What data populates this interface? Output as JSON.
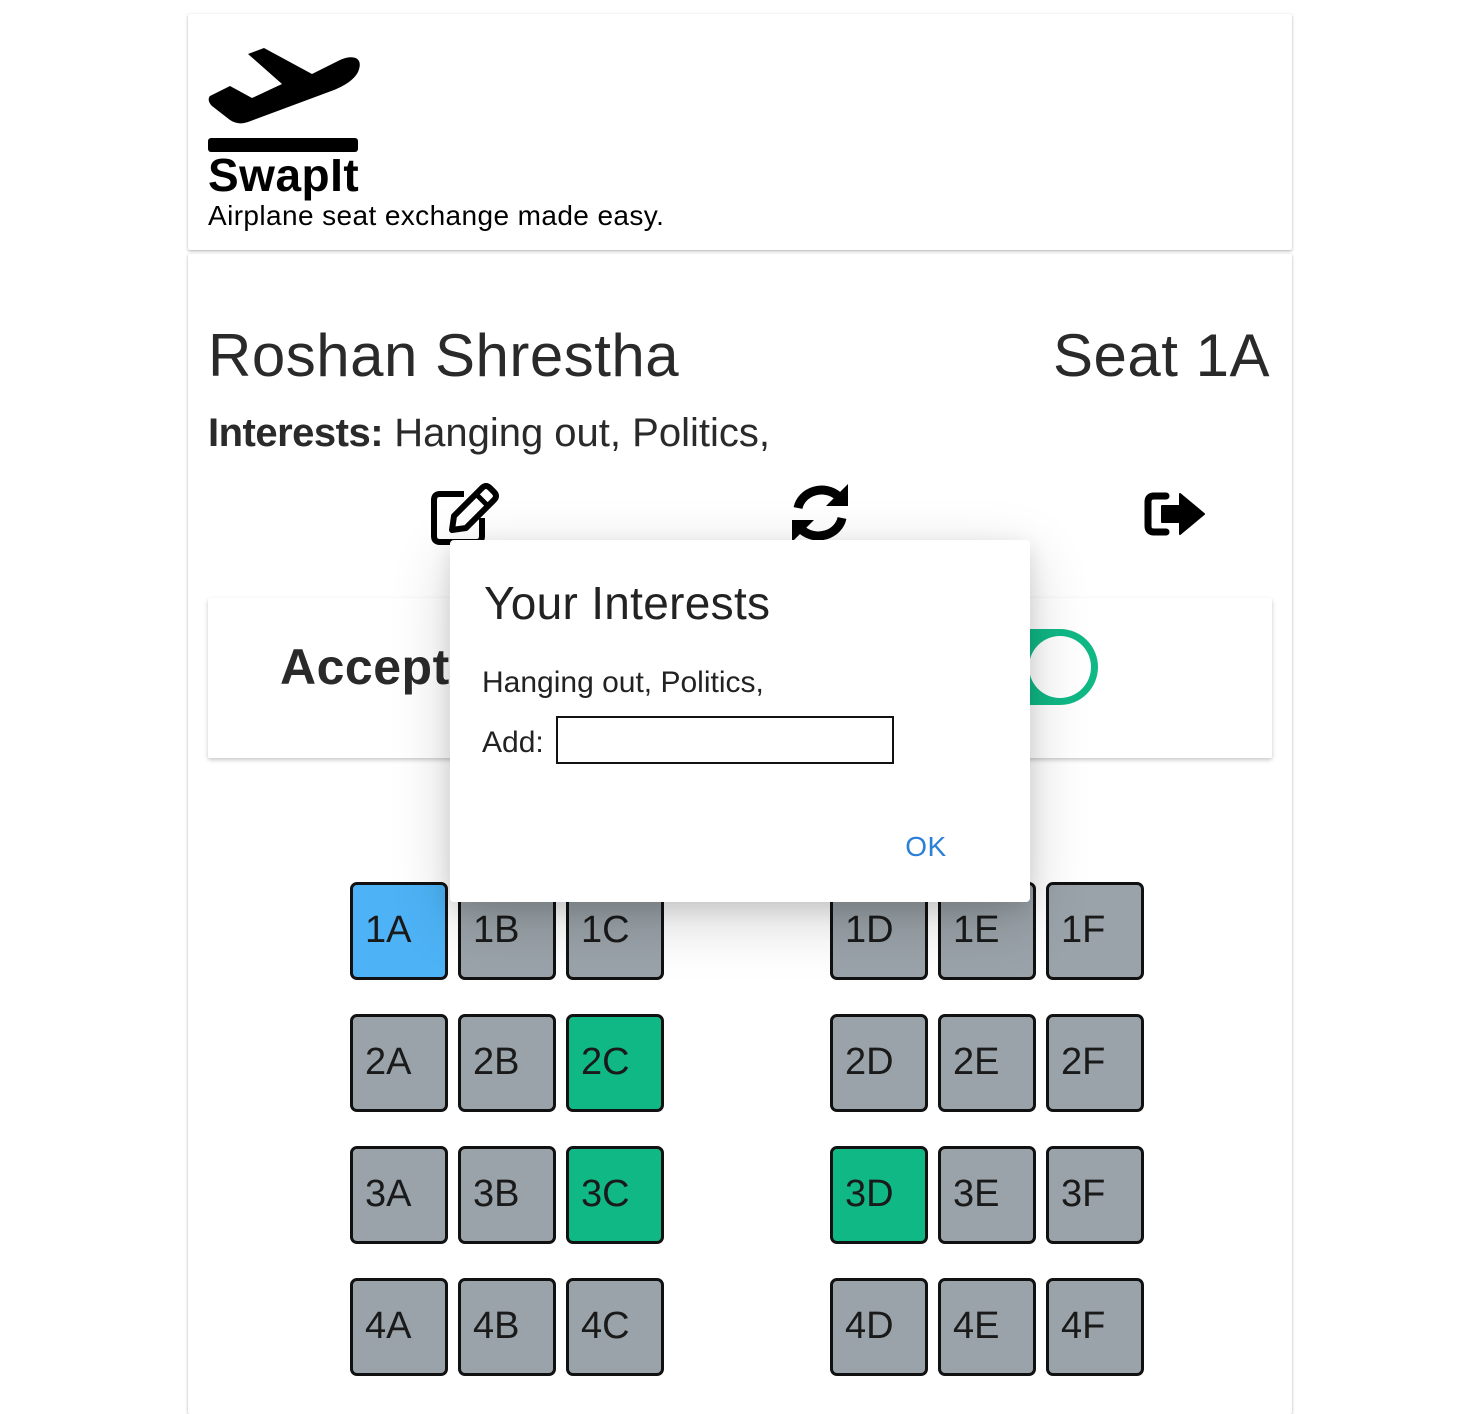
{
  "header": {
    "app_title": "SwapIt",
    "tagline": "Airplane seat exchange made easy."
  },
  "profile": {
    "name": "Roshan Shrestha",
    "seat_label": "Seat 1A",
    "interests_label": "Interests:",
    "interests_value": "Hanging out, Politics,"
  },
  "actions": {
    "edit_icon": "edit-icon",
    "refresh_icon": "refresh-icon",
    "logout_icon": "sign-out-icon"
  },
  "accept_card": {
    "label": "Accept",
    "toggle_on": true,
    "toggle_color": "#10b886"
  },
  "seat_colors": {
    "mine": "#4db3f6",
    "match": "#10b886",
    "other": "#9aa3a9"
  },
  "seats": [
    {
      "id": "1A",
      "state": "mine"
    },
    {
      "id": "1B",
      "state": "other"
    },
    {
      "id": "1C",
      "state": "other"
    },
    {
      "id": "1D",
      "state": "other"
    },
    {
      "id": "1E",
      "state": "other"
    },
    {
      "id": "1F",
      "state": "other"
    },
    {
      "id": "2A",
      "state": "other"
    },
    {
      "id": "2B",
      "state": "other"
    },
    {
      "id": "2C",
      "state": "match"
    },
    {
      "id": "2D",
      "state": "other"
    },
    {
      "id": "2E",
      "state": "other"
    },
    {
      "id": "2F",
      "state": "other"
    },
    {
      "id": "3A",
      "state": "other"
    },
    {
      "id": "3B",
      "state": "other"
    },
    {
      "id": "3C",
      "state": "match"
    },
    {
      "id": "3D",
      "state": "match"
    },
    {
      "id": "3E",
      "state": "other"
    },
    {
      "id": "3F",
      "state": "other"
    },
    {
      "id": "4A",
      "state": "other"
    },
    {
      "id": "4B",
      "state": "other"
    },
    {
      "id": "4C",
      "state": "other"
    },
    {
      "id": "4D",
      "state": "other"
    },
    {
      "id": "4E",
      "state": "other"
    },
    {
      "id": "4F",
      "state": "other"
    }
  ],
  "dialog": {
    "title": "Your Interests",
    "interests_text": "Hanging out, Politics,",
    "add_label": "Add:",
    "add_value": "",
    "ok_label": "OK"
  }
}
